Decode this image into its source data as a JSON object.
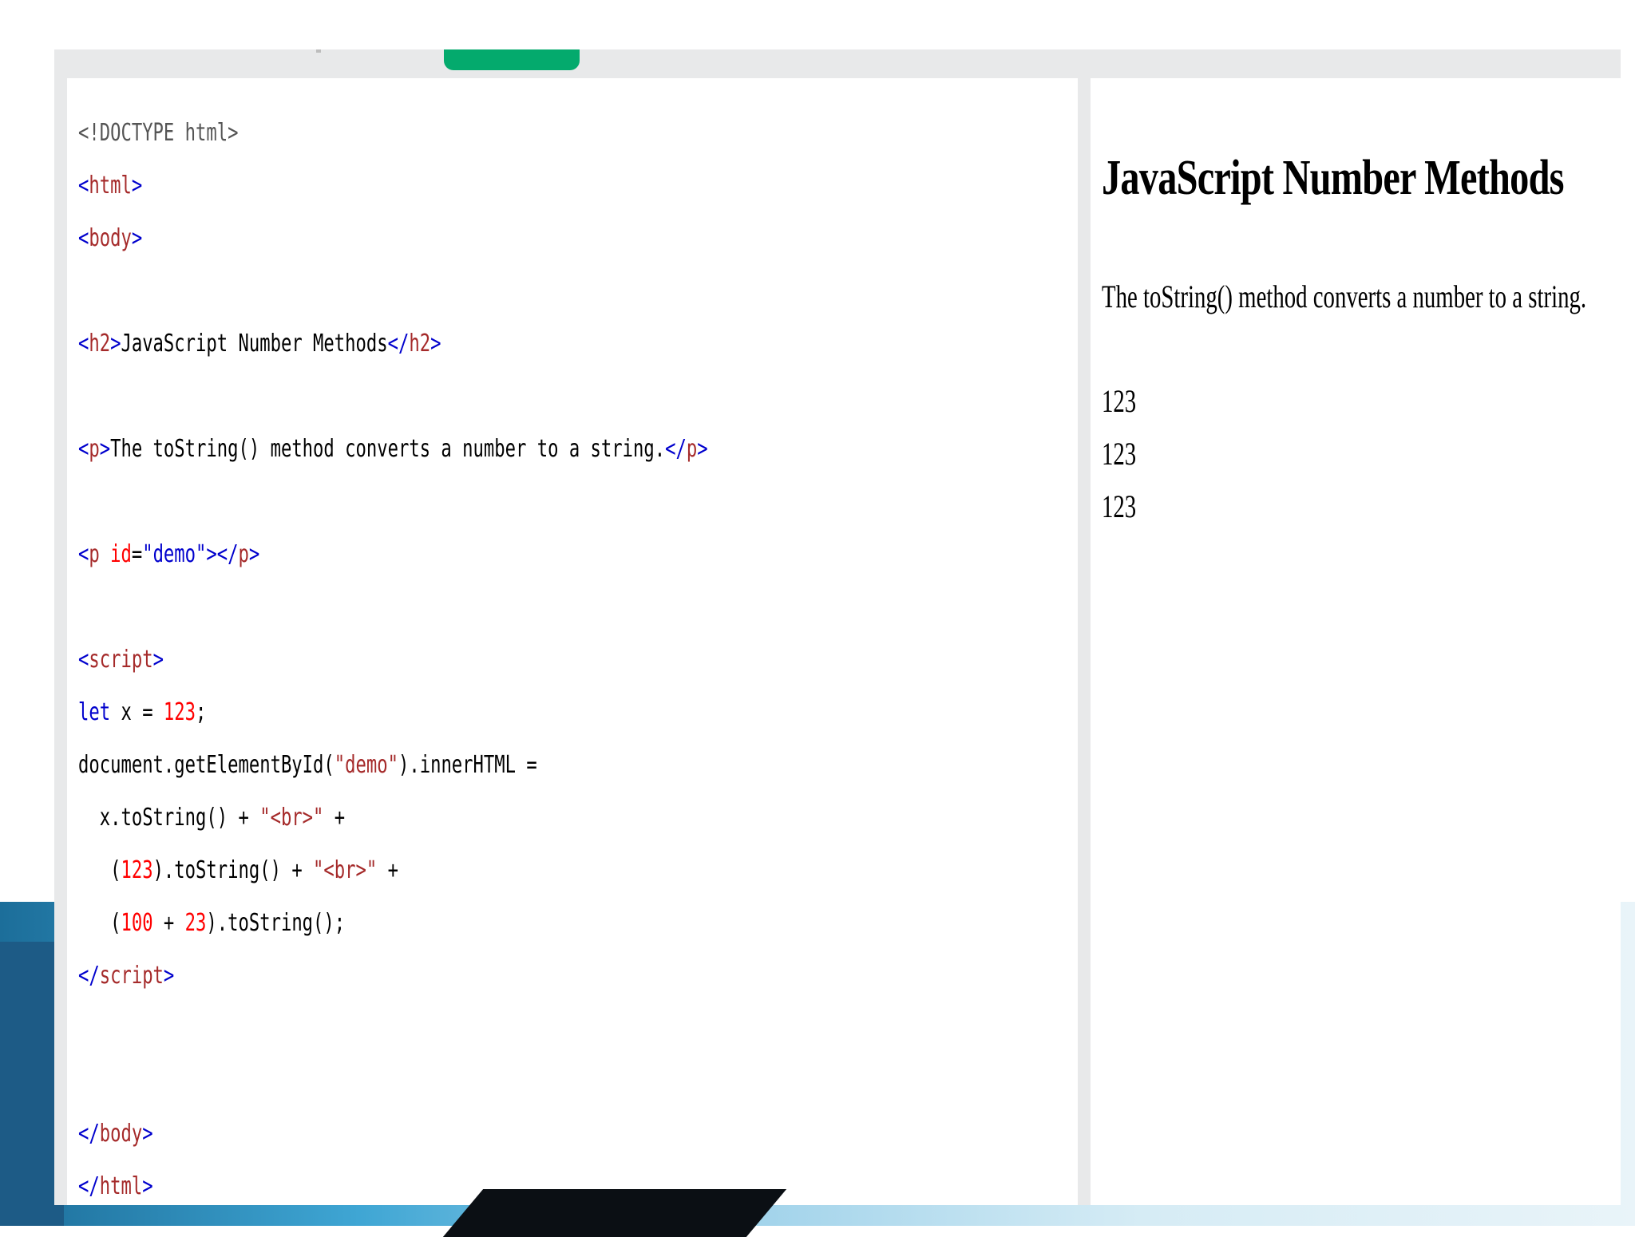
{
  "editor": {
    "lines": [
      [
        {
          "t": "<!DOCTYPE html>",
          "c": "com"
        }
      ],
      [
        {
          "t": "<",
          "c": "br"
        },
        {
          "t": "html",
          "c": "tag"
        },
        {
          "t": ">",
          "c": "br"
        }
      ],
      [
        {
          "t": "<",
          "c": "br"
        },
        {
          "t": "body",
          "c": "tag"
        },
        {
          "t": ">",
          "c": "br"
        }
      ],
      [],
      [
        {
          "t": "<",
          "c": "br"
        },
        {
          "t": "h2",
          "c": "tag"
        },
        {
          "t": ">",
          "c": "br"
        },
        {
          "t": "JavaScript Number Methods",
          "c": "plain"
        },
        {
          "t": "</",
          "c": "br"
        },
        {
          "t": "h2",
          "c": "tag"
        },
        {
          "t": ">",
          "c": "br"
        }
      ],
      [],
      [
        {
          "t": "<",
          "c": "br"
        },
        {
          "t": "p",
          "c": "tag"
        },
        {
          "t": ">",
          "c": "br"
        },
        {
          "t": "The toString() method converts a number to a string.",
          "c": "plain"
        },
        {
          "t": "</",
          "c": "br"
        },
        {
          "t": "p",
          "c": "tag"
        },
        {
          "t": ">",
          "c": "br"
        }
      ],
      [],
      [
        {
          "t": "<",
          "c": "br"
        },
        {
          "t": "p",
          "c": "tag"
        },
        {
          "t": " ",
          "c": "plain"
        },
        {
          "t": "id",
          "c": "attr"
        },
        {
          "t": "=",
          "c": "plain"
        },
        {
          "t": "\"demo\"",
          "c": "val"
        },
        {
          "t": "></",
          "c": "br"
        },
        {
          "t": "p",
          "c": "tag"
        },
        {
          "t": ">",
          "c": "br"
        }
      ],
      [],
      [
        {
          "t": "<",
          "c": "br"
        },
        {
          "t": "script",
          "c": "tag"
        },
        {
          "t": ">",
          "c": "br"
        }
      ],
      [
        {
          "t": "let",
          "c": "kw"
        },
        {
          "t": " x = ",
          "c": "plain"
        },
        {
          "t": "123",
          "c": "num"
        },
        {
          "t": ";",
          "c": "plain"
        }
      ],
      [
        {
          "t": "document.getElementById(",
          "c": "plain"
        },
        {
          "t": "\"demo\"",
          "c": "str"
        },
        {
          "t": ").innerHTML =",
          "c": "plain"
        }
      ],
      [
        {
          "t": "  x.toString() + ",
          "c": "plain"
        },
        {
          "t": "\"<br>\"",
          "c": "str"
        },
        {
          "t": " +",
          "c": "plain"
        }
      ],
      [
        {
          "t": "   (",
          "c": "plain"
        },
        {
          "t": "123",
          "c": "num"
        },
        {
          "t": ").toString() + ",
          "c": "plain"
        },
        {
          "t": "\"<br>\"",
          "c": "str"
        },
        {
          "t": " +",
          "c": "plain"
        }
      ],
      [
        {
          "t": "   (",
          "c": "plain"
        },
        {
          "t": "100",
          "c": "num"
        },
        {
          "t": " + ",
          "c": "plain"
        },
        {
          "t": "23",
          "c": "num"
        },
        {
          "t": ").toString();",
          "c": "plain"
        }
      ],
      [
        {
          "t": "</",
          "c": "br"
        },
        {
          "t": "script",
          "c": "tag"
        },
        {
          "t": ">",
          "c": "br"
        }
      ],
      [],
      [],
      [
        {
          "t": "</",
          "c": "br"
        },
        {
          "t": "body",
          "c": "tag"
        },
        {
          "t": ">",
          "c": "br"
        }
      ],
      [
        {
          "t": "</",
          "c": "br"
        },
        {
          "t": "html",
          "c": "tag"
        },
        {
          "t": ">",
          "c": "br"
        }
      ]
    ]
  },
  "result": {
    "heading": "JavaScript Number Methods",
    "paragraph": "The toString() method converts a number to a string.",
    "output": [
      "123",
      "123",
      "123"
    ]
  },
  "colors": {
    "run_button": "#04aa6d",
    "tag": "#a52a2a",
    "bracket": "#0000cd",
    "number": "#ff0000"
  }
}
